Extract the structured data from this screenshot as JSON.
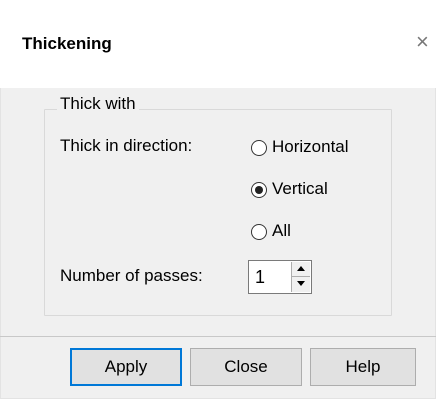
{
  "window": {
    "title": "Thickening",
    "close_glyph": "×"
  },
  "group": {
    "title": "Thick with",
    "direction_label": "Thick in direction:",
    "options": [
      {
        "label": "Horizontal",
        "checked": false
      },
      {
        "label": "Vertical",
        "checked": true
      },
      {
        "label": "All",
        "checked": false
      }
    ],
    "passes_label": "Number of passes:",
    "passes_value": "1"
  },
  "buttons": {
    "apply": "Apply",
    "close": "Close",
    "help": "Help"
  },
  "colors": {
    "default_button_border": "#0078d7",
    "dialog_background": "#f0f0f0"
  }
}
